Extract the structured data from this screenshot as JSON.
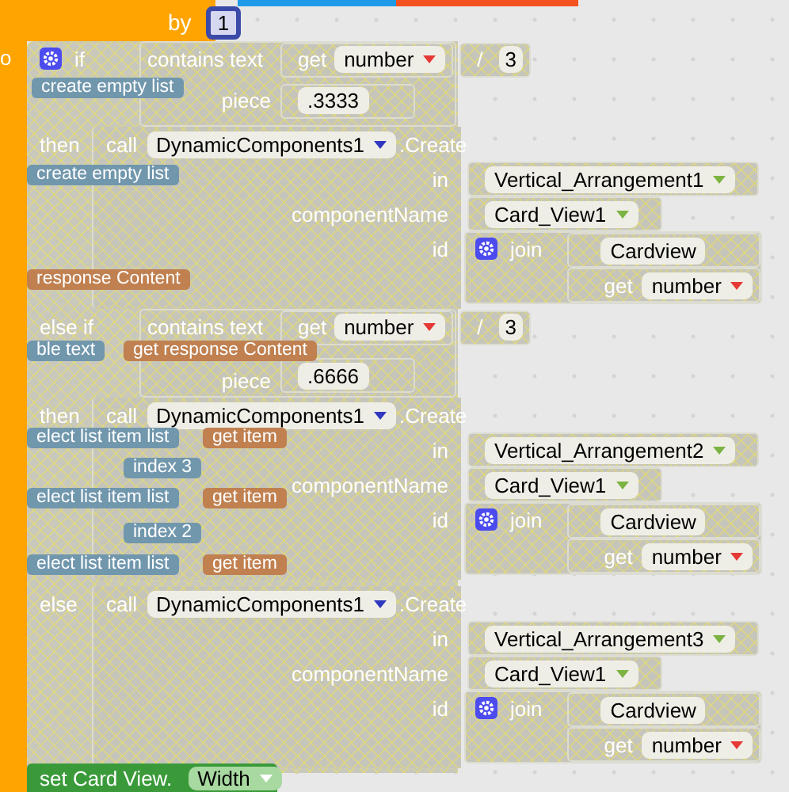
{
  "event": {
    "keyword": "o",
    "by_label": "by",
    "by_value": "1"
  },
  "if_block": {
    "branches": [
      {
        "kind": "if",
        "label": "if",
        "condition": {
          "op": "contains text",
          "getter": "get",
          "variable": "number",
          "operator": "/",
          "divisor": "3",
          "piece_label": "piece",
          "piece": ".3333"
        },
        "then_label": "then",
        "call": {
          "keyword": "call",
          "component": "DynamicComponents1",
          "method": ".Create",
          "args": [
            {
              "name": "in",
              "kind": "dropdown",
              "value": "Vertical_Arrangement1"
            },
            {
              "name": "componentName",
              "kind": "dropdown",
              "value": "Card_View1"
            },
            {
              "name": "id",
              "kind": "join",
              "label": "join",
              "text": "Cardview",
              "getter": "get",
              "variable": "number"
            }
          ]
        }
      },
      {
        "kind": "else_if",
        "label": "else if",
        "condition": {
          "op": "contains text",
          "getter": "get",
          "variable": "number",
          "operator": "/",
          "divisor": "3",
          "piece_label": "piece",
          "piece": ".6666"
        },
        "then_label": "then",
        "call": {
          "keyword": "call",
          "component": "DynamicComponents1",
          "method": ".Create",
          "args": [
            {
              "name": "in",
              "kind": "dropdown",
              "value": "Vertical_Arrangement2"
            },
            {
              "name": "componentName",
              "kind": "dropdown",
              "value": "Card_View1"
            },
            {
              "name": "id",
              "kind": "join",
              "label": "join",
              "text": "Cardview",
              "getter": "get",
              "variable": "number"
            }
          ]
        }
      },
      {
        "kind": "else",
        "label": "else",
        "call": {
          "keyword": "call",
          "component": "DynamicComponents1",
          "method": ".Create",
          "args": [
            {
              "name": "in",
              "kind": "dropdown",
              "value": "Vertical_Arrangement3"
            },
            {
              "name": "componentName",
              "kind": "dropdown",
              "value": "Card_View1"
            },
            {
              "name": "id",
              "kind": "join",
              "label": "join",
              "text": "Cardview",
              "getter": "get",
              "variable": "number"
            }
          ]
        }
      }
    ]
  },
  "ghost_blocks": [
    {
      "text": "create empty list",
      "color": "#7197ad"
    },
    {
      "text": "create empty list",
      "color": "#7197ad"
    },
    {
      "text": "response Content",
      "color": "#c08050"
    },
    {
      "text": "ble  text",
      "color": "#7197ad"
    },
    {
      "text": "get  response Content",
      "color": "#c08050"
    },
    {
      "text": "elect list item  list",
      "color": "#7197ad"
    },
    {
      "text": "get  item",
      "color": "#c08050"
    },
    {
      "text": "index  3",
      "color": "#7197ad"
    },
    {
      "text": "elect list item  list",
      "color": "#7197ad"
    },
    {
      "text": "get  item",
      "color": "#c08050"
    },
    {
      "text": "index  2",
      "color": "#7197ad"
    },
    {
      "text": "elect list item  list",
      "color": "#7197ad"
    },
    {
      "text": "get  item",
      "color": "#c08050"
    }
  ],
  "bottom_block": {
    "label": "set Card View.",
    "property": "Width"
  }
}
